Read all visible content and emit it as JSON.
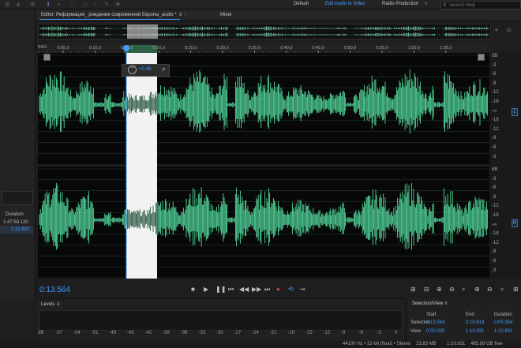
{
  "toolbar": {
    "tool_icons": [
      "wave-tool-icon",
      "spectral-tool-icon",
      "time-selection-icon",
      "razor-icon",
      "brush-icon",
      "spot-heal-icon"
    ]
  },
  "workspaces": [
    {
      "label": "Default"
    },
    {
      "label": "Edit Audio to Video"
    },
    {
      "label": "Radio Production"
    }
  ],
  "search": {
    "placeholder": "Search Help"
  },
  "editor": {
    "tab_label": "Editor: Реформация_ рождение современной Европы_audio *",
    "mixer_label": "Mixer",
    "hms_label": "hms",
    "gain_label": "+0 dB"
  },
  "ruler": {
    "ticks": [
      "0;05,0",
      "0;10,0",
      "0;15,0",
      "0;20,0",
      "0;25,0",
      "0;30,0",
      "0;35,0",
      "0;40,0",
      "0;45,0",
      "0;50,0",
      "0;55,0",
      "1;00,0",
      "1;05,0"
    ]
  },
  "db_scale": {
    "top": [
      "dB",
      "-3",
      "-6",
      "-9",
      "-12",
      "-18",
      "-∞",
      "-18",
      "-12",
      "-9",
      "-6",
      "-3"
    ],
    "bottom": [
      "dB",
      "-3",
      "-6",
      "-9",
      "-12",
      "-18",
      "-∞",
      "-18",
      "-12",
      "-9",
      "-6",
      "-3"
    ],
    "channel_left": "L",
    "channel_right": "R"
  },
  "left_panel": {
    "duration_label": "Duration",
    "duration_value": "1:47:59.120",
    "selection_value": "1:10.831"
  },
  "transport": {
    "current_time": "0:13.564"
  },
  "levels": {
    "title": "Levels",
    "scale": [
      "dB",
      "-57",
      "-54",
      "-51",
      "-48",
      "-45",
      "-42",
      "-39",
      "-36",
      "-33",
      "-30",
      "-27",
      "-24",
      "-21",
      "-18",
      "-15",
      "-12",
      "-9",
      "-6",
      "-3",
      "0"
    ]
  },
  "selection_view": {
    "title": "Selection/View",
    "headers": [
      "Start",
      "End",
      "Duration"
    ],
    "rows": [
      {
        "label": "Selection",
        "start": "0:13.564",
        "end": "0:18.619",
        "duration": "0:05.054"
      },
      {
        "label": "View",
        "start": "0:00.000",
        "end": "1:10.831",
        "duration": "1:10.831"
      }
    ]
  },
  "status": {
    "format": "44100 Hz • 32-bit (float) • Stereo",
    "size": "23,83 MB",
    "duration": "1:10.831",
    "free": "485,99 GB free"
  },
  "colors": {
    "accent": "#3f9cff",
    "waveform": "#52d69a",
    "selection": "#f2f2f2",
    "background": "#080808"
  }
}
